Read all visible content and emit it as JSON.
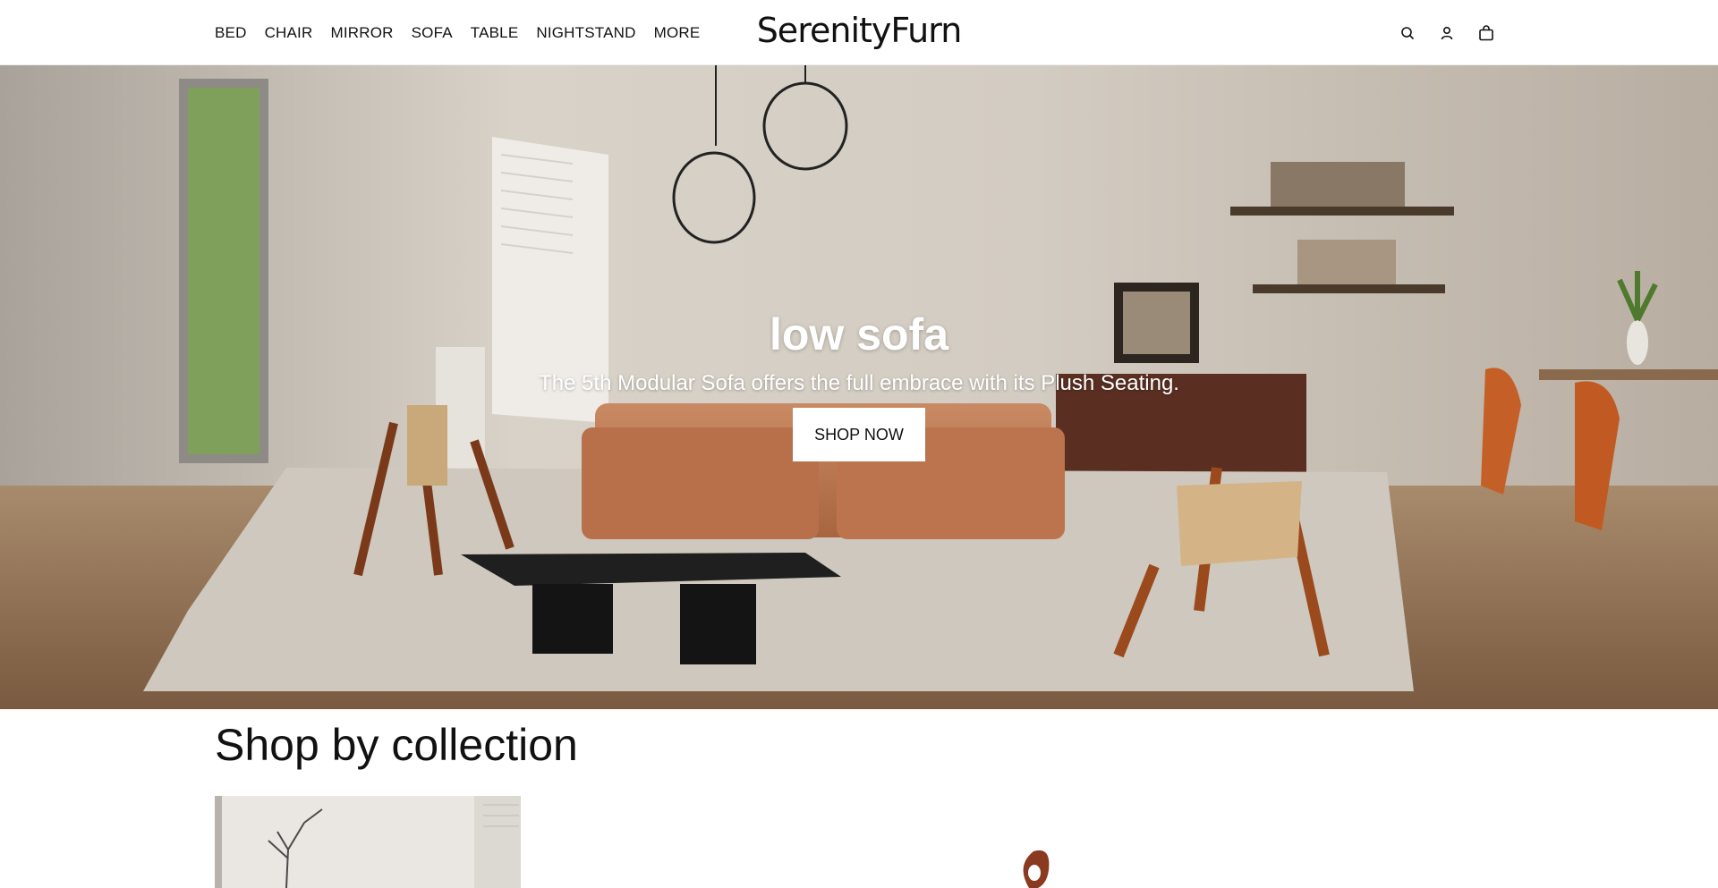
{
  "header": {
    "nav": [
      "BED",
      "CHAIR",
      "MIRROR",
      "SOFA",
      "TABLE",
      "NIGHTSTAND",
      "MORE"
    ],
    "logo": "SerenityFurn",
    "icons": [
      "search-icon",
      "account-icon",
      "cart-icon"
    ]
  },
  "hero": {
    "title": "low sofa",
    "subtitle": "The 5th Modular Sofa offers the full embrace with its Plush Seating.",
    "button": "SHOP NOW"
  },
  "collection": {
    "title": "Shop by collection"
  }
}
